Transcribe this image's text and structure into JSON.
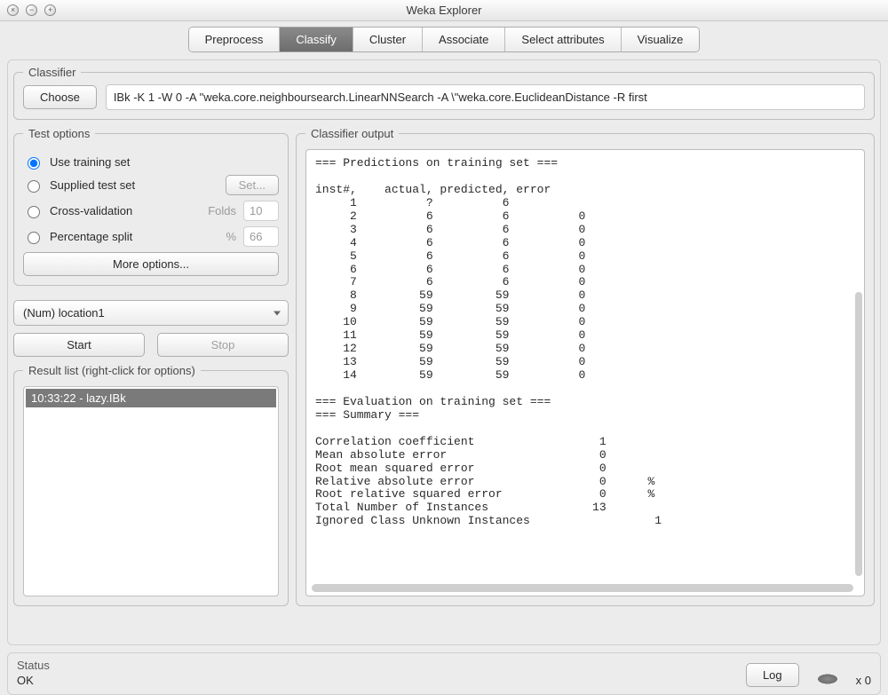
{
  "window": {
    "title": "Weka Explorer"
  },
  "tabs": {
    "items": [
      "Preprocess",
      "Classify",
      "Cluster",
      "Associate",
      "Select attributes",
      "Visualize"
    ],
    "active": "Classify"
  },
  "classifier": {
    "legend": "Classifier",
    "choose_label": "Choose",
    "command": "IBk -K 1 -W 0 -A \"weka.core.neighboursearch.LinearNNSearch -A \\\"weka.core.EuclideanDistance -R first"
  },
  "test_options": {
    "legend": "Test options",
    "use_training_label": "Use training set",
    "supplied_label": "Supplied test set",
    "set_button": "Set...",
    "cv_label": "Cross-validation",
    "folds_label": "Folds",
    "folds_value": "10",
    "split_label": "Percentage split",
    "pct_symbol": "%",
    "pct_value": "66",
    "more_options": "More options...",
    "selected": "use_training"
  },
  "attribute_select": {
    "value": "(Num) location1"
  },
  "run": {
    "start": "Start",
    "stop": "Stop"
  },
  "result_list": {
    "legend": "Result list (right-click for options)",
    "items": [
      "10:33:22 - lazy.IBk"
    ]
  },
  "output": {
    "legend": "Classifier output",
    "text": "=== Predictions on training set ===\n\ninst#,    actual, predicted, error\n     1          ?          6\n     2          6          6          0\n     3          6          6          0\n     4          6          6          0\n     5          6          6          0\n     6          6          6          0\n     7          6          6          0\n     8         59         59          0\n     9         59         59          0\n    10         59         59          0\n    11         59         59          0\n    12         59         59          0\n    13         59         59          0\n    14         59         59          0\n\n=== Evaluation on training set ===\n=== Summary ===\n\nCorrelation coefficient                  1\nMean absolute error                      0\nRoot mean squared error                  0\nRelative absolute error                  0      %\nRoot relative squared error              0      %\nTotal Number of Instances               13\nIgnored Class Unknown Instances                  1"
  },
  "status": {
    "legend": "Status",
    "text": "OK",
    "log_button": "Log",
    "count": "x 0"
  }
}
